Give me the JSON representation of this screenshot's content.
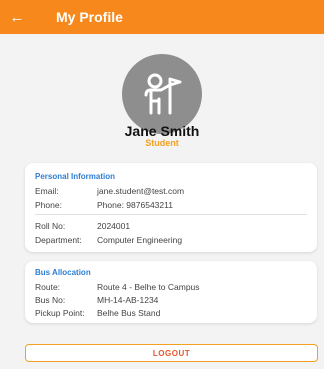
{
  "header": {
    "title": "My Profile"
  },
  "profile": {
    "name": "Jane Smith",
    "role": "Student"
  },
  "personal": {
    "section_title": "Personal Information",
    "email": {
      "label": "Email:",
      "value": "jane.student@test.com"
    },
    "phone": {
      "label": "Phone:",
      "value": "Phone: 9876543211"
    },
    "roll": {
      "label": "Roll No:",
      "value": "2024001"
    },
    "department": {
      "label": "Department:",
      "value": "Computer Engineering"
    }
  },
  "bus": {
    "section_title": "Bus Allocation",
    "route": {
      "label": "Route:",
      "value": "Route 4 - Belhe to Campus"
    },
    "bus_no": {
      "label": "Bus No:",
      "value": "MH-14-AB-1234"
    },
    "pickup": {
      "label": "Pickup Point:",
      "value": "Belhe Bus Stand"
    }
  },
  "logout_label": "LOGOUT",
  "icons": {
    "back": "arrow-left-icon",
    "avatar": "person-with-flag-icon"
  },
  "colors": {
    "accent": "#f6881c",
    "section_title": "#2d7ed4",
    "role": "#f3a122",
    "logout_text": "#e4572e"
  }
}
